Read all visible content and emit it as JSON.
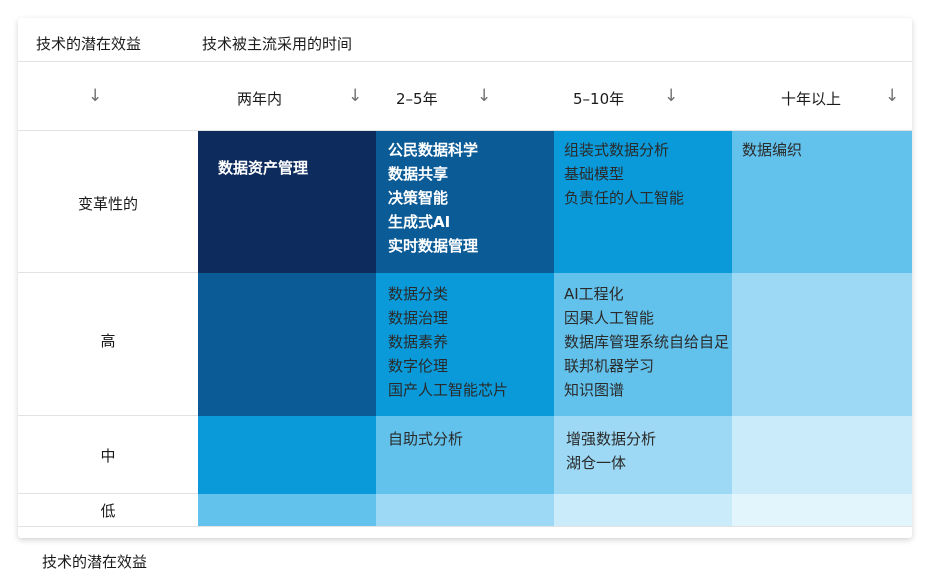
{
  "header": {
    "row_axis_title": "技术的潜在效益",
    "col_axis_title": "技术被主流采用的时间"
  },
  "columns": [
    {
      "label": "两年内"
    },
    {
      "label": "2–5年"
    },
    {
      "label": "5–10年"
    },
    {
      "label": "十年以上"
    }
  ],
  "arrow_glyph": "↓",
  "rows": [
    {
      "label": "变革性的"
    },
    {
      "label": "高"
    },
    {
      "label": "中"
    },
    {
      "label": "低"
    }
  ],
  "cells": {
    "r0": {
      "c0": {
        "items": [
          "数据资产管理"
        ],
        "color": "#0d2b5c"
      },
      "c1": {
        "items": [
          "公民数据科学",
          "数据共享",
          "决策智能",
          "生成式AI",
          "实时数据管理"
        ],
        "color": "#0b5b96"
      },
      "c2": {
        "items": [
          "组装式数据分析",
          "基础模型",
          "负责任的人工智能"
        ],
        "color": "#0a9ad9"
      },
      "c3": {
        "items": [
          "数据编织"
        ],
        "color": "#63c2ec"
      }
    },
    "r1": {
      "c0": {
        "items": [],
        "color": "#0b5b96"
      },
      "c1": {
        "items": [
          "数据分类",
          "数据治理",
          "数据素养",
          "数字伦理",
          "国产人工智能芯片"
        ],
        "color": "#0a9ad9"
      },
      "c2": {
        "items": [
          "AI工程化",
          "因果人工智能",
          "数据库管理系统自给自足",
          "联邦机器学习",
          "知识图谱"
        ],
        "color": "#63c2ec"
      },
      "c3": {
        "items": [],
        "color": "#9dd9f4"
      }
    },
    "r2": {
      "c0": {
        "items": [],
        "color": "#0a9ad9"
      },
      "c1": {
        "items": [
          "自助式分析"
        ],
        "color": "#63c2ec"
      },
      "c2": {
        "items": [
          "增强数据分析",
          "湖仓一体"
        ],
        "color": "#9dd9f4"
      },
      "c3": {
        "items": [],
        "color": "#c9ebfa"
      }
    },
    "r3": {
      "c0": {
        "items": [],
        "color": "#63c2ec"
      },
      "c1": {
        "items": [],
        "color": "#9dd9f4"
      },
      "c2": {
        "items": [],
        "color": "#c9ebfa"
      },
      "c3": {
        "items": [],
        "color": "#e2f5fd"
      }
    }
  },
  "footer": {
    "caption": "技术的潜在效益"
  }
}
